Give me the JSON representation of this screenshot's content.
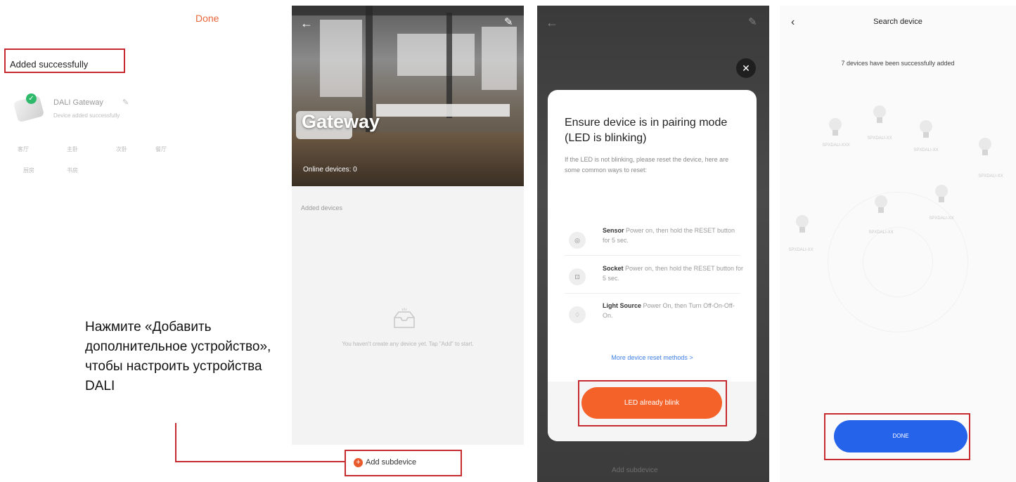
{
  "panel1": {
    "done_label": "Done",
    "added_title": "Added successfully",
    "device_name": "DALI Gateway",
    "device_status": "Device added successfully",
    "chips": [
      "客厅",
      "主卧",
      "次卧",
      "餐厅",
      "厨房",
      "书房"
    ]
  },
  "panel2": {
    "title": "Gateway",
    "online_devices": "Online devices: 0",
    "added_devices_label": "Added devices",
    "empty_text": "You haven't create any device yet. Tap \"Add\" to start.",
    "add_subdevice_label": "Add subdevice"
  },
  "instruction": "Нажмите «Добавить дополнительное устройство», чтобы настроить устройства DALI",
  "panel3": {
    "title": "Ensure device is in pairing mode (LED is blinking)",
    "description": "If the LED is not blinking, please reset the device, here are some common ways to reset:",
    "rows": [
      {
        "name": "Sensor",
        "text": "Power on, then hold the RESET button for 5 sec."
      },
      {
        "name": "Socket",
        "text": "Power on, then hold the RESET button for 5 sec."
      },
      {
        "name": "Light Source",
        "text": "Power On, then Turn Off-On-Off-On."
      }
    ],
    "more_link": "More device reset methods >",
    "confirm_button": "LED already blink",
    "underlay_label": "Add subdevice"
  },
  "panel4": {
    "title": "Search device",
    "message": "7 devices have been successfully added",
    "bulb_labels": [
      "SPXDALI-XXX",
      "SPXDALI-XX",
      "SPXDALI-XX",
      "SPXDALI-XX",
      "SPXDALI-XX",
      "SPXDALI-XX",
      "SPXDALI-XX"
    ],
    "done_button": "DONE"
  },
  "colors": {
    "highlight": "#c52b2f",
    "accent_orange": "#f4622a",
    "done_blue": "#2563eb",
    "success_green": "#2fba6b"
  }
}
